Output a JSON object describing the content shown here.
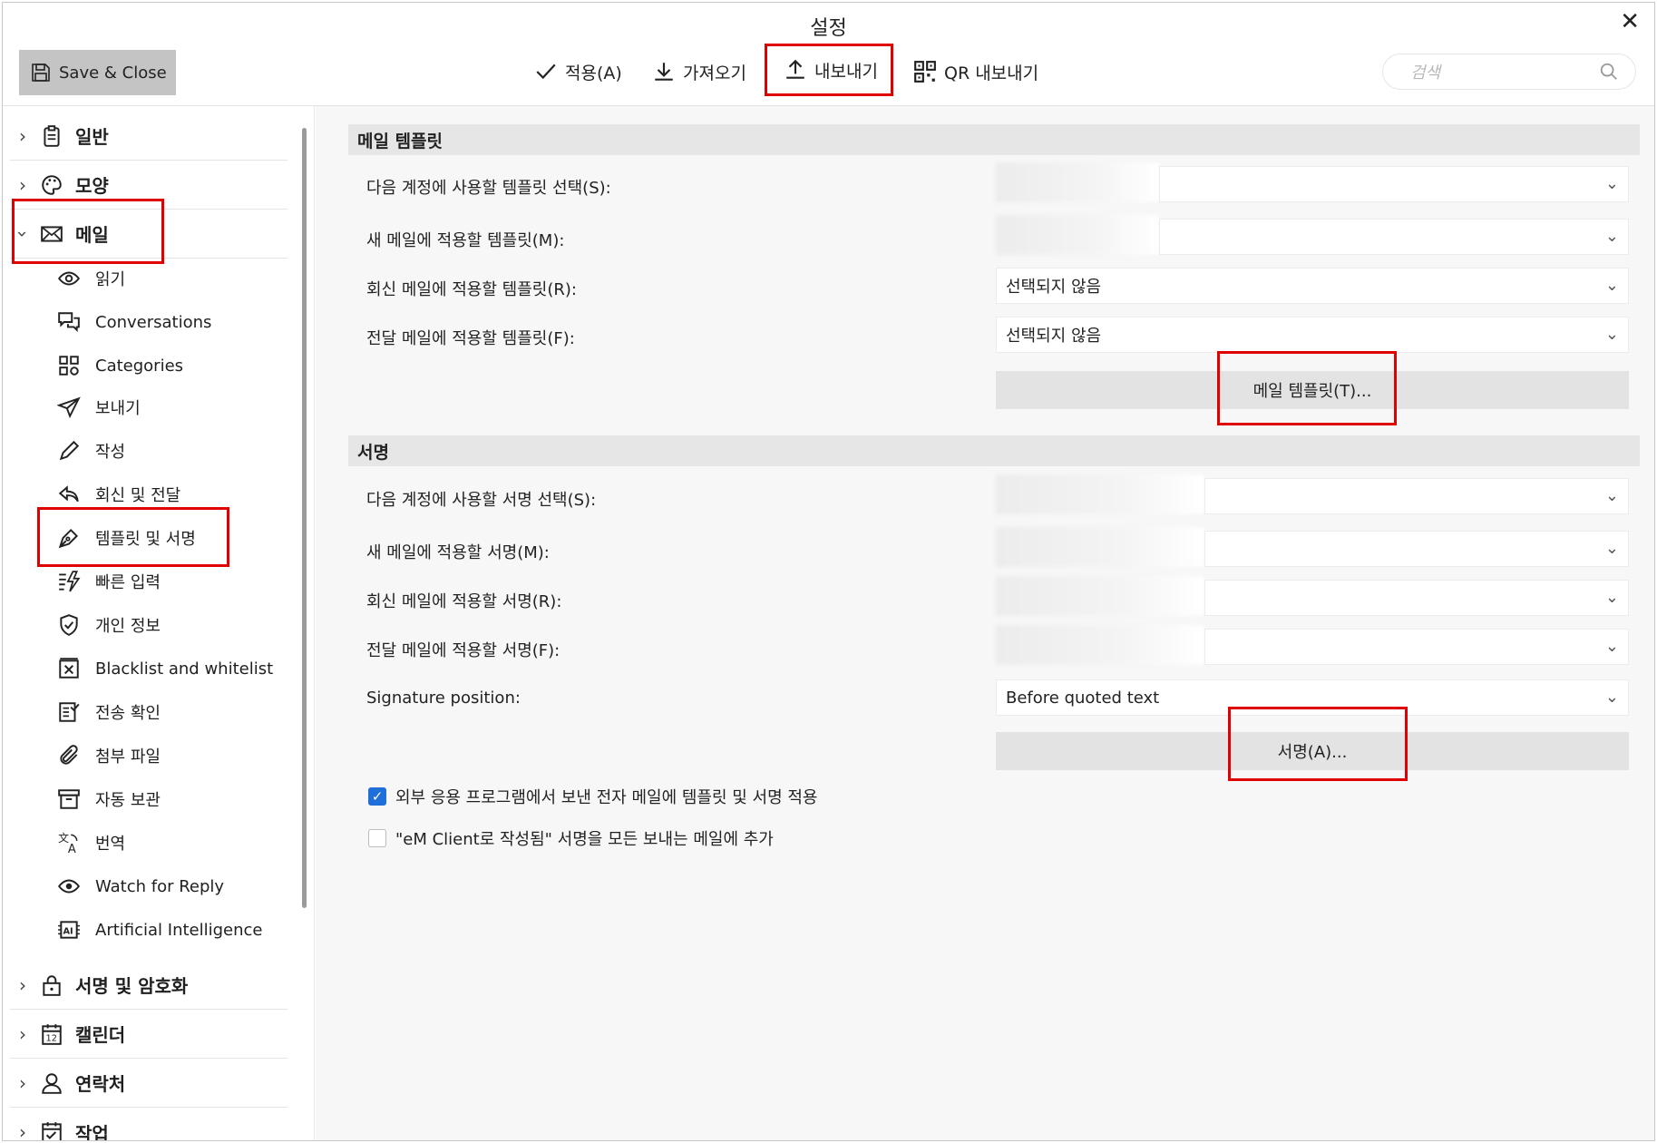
{
  "window": {
    "title": "설정"
  },
  "toolbar": {
    "save_close": "Save & Close",
    "apply": "적용(A)",
    "import": "가져오기",
    "export": "내보내기",
    "qr_export": "QR 내보내기",
    "search_placeholder": "검색"
  },
  "sidebar": {
    "categories": {
      "general": "일반",
      "appearance": "모양",
      "mail": "메일",
      "signing": "서명 및 암호화",
      "calendar": "캘린더",
      "contacts": "연락처",
      "tasks": "작업"
    },
    "mail_items": {
      "reading": "읽기",
      "conversations": "Conversations",
      "categories": "Categories",
      "sending": "보내기",
      "compose": "작성",
      "reply_forward": "회신 및 전달",
      "templates_signatures": "템플릿 및 서명",
      "quick_text": "빠른 입력",
      "privacy": "개인 정보",
      "blacklist": "Blacklist and whitelist",
      "delivery": "전송 확인",
      "attachments": "첨부 파일",
      "autoarchive": "자동 보관",
      "translate": "번역",
      "watch_reply": "Watch for Reply",
      "ai": "Artificial Intelligence"
    }
  },
  "templates": {
    "header": "메일 템플릿",
    "select_account_label": "다음 계정에 사용할 템플릿 선택(S):",
    "new_mail_label": "새 메일에 적용할 템플릿(M):",
    "reply_label": "회신 메일에 적용할 템플릿(R):",
    "reply_value": "선택되지 않음",
    "forward_label": "전달 메일에 적용할 템플릿(F):",
    "forward_value": "선택되지 않음",
    "button": "메일 템플릿(T)..."
  },
  "signatures": {
    "header": "서명",
    "select_account_label": "다음 계정에 사용할 서명 선택(S):",
    "new_mail_label": "새 메일에 적용할 서명(M):",
    "reply_label": "회신 메일에 적용할 서명(R):",
    "forward_label": "전달 메일에 적용할 서명(F):",
    "position_label": "Signature position:",
    "position_value": "Before quoted text",
    "button": "서명(A)..."
  },
  "options": {
    "external_apps": "외부 응용 프로그램에서 보낸 전자 메일에 템플릿 및 서명 적용",
    "external_apps_checked": true,
    "written_by": "\"eM Client로 작성됨\" 서명을 모든 보내는 메일에 추가",
    "written_by_checked": false
  },
  "colors": {
    "highlight": "#e00000",
    "selected_bg": "#dde9f8",
    "checkbox_on": "#1e6fd9"
  }
}
